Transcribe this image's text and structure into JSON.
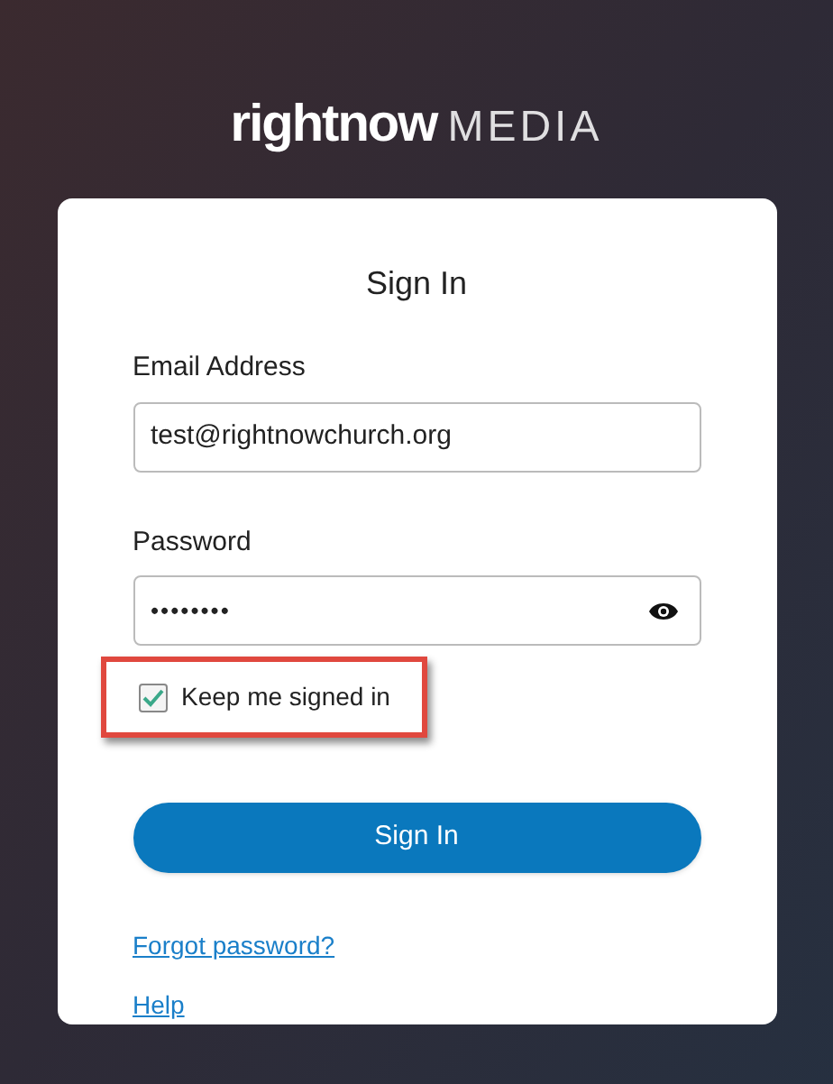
{
  "logo": {
    "brand": "rightnow",
    "suffix": "MEDIA"
  },
  "form": {
    "title": "Sign In",
    "fields": [
      {
        "label": "Email Address",
        "value": "test@rightnowchurch.org",
        "kind": "text"
      },
      {
        "label": "Password",
        "value": "••••••••",
        "kind": "password"
      }
    ],
    "remember": {
      "label": "Keep me signed in",
      "checked": true,
      "highlighted": true
    },
    "submit": "Sign In",
    "links": [
      "Forgot password?",
      "Help"
    ]
  }
}
